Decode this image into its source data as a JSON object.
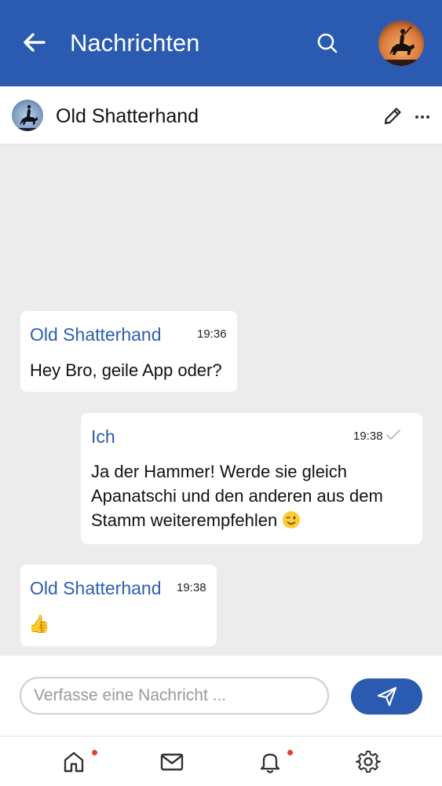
{
  "appbar": {
    "title": "Nachrichten",
    "back_icon": "arrow-left-icon",
    "search_icon": "search-icon",
    "background": "#2a5bb1"
  },
  "conversation": {
    "name": "Old Shatterhand",
    "edit_icon": "pencil-icon",
    "more_icon": "more-horizontal-icon"
  },
  "messages": [
    {
      "sender": "Old Shatterhand",
      "time": "19:36",
      "text": "Hey Bro, geile App oder?"
    },
    {
      "sender": "Ich",
      "time": "19:38",
      "text": "Ja der Hammer! Werde sie gleich Apanatschi und den anderen aus dem Stamm weiterempfehlen",
      "status": "check-icon",
      "emoji": "winking-face"
    },
    {
      "sender": "Old Shatterhand",
      "time": "19:38",
      "text": "👍"
    }
  ],
  "composer": {
    "placeholder": "Verfasse eine Nachricht ...",
    "value": "",
    "send_icon": "send-icon"
  },
  "bottom_nav": {
    "items": [
      "home-icon",
      "mail-icon",
      "bell-icon",
      "gear-icon"
    ],
    "notification_color": "#e04034"
  }
}
